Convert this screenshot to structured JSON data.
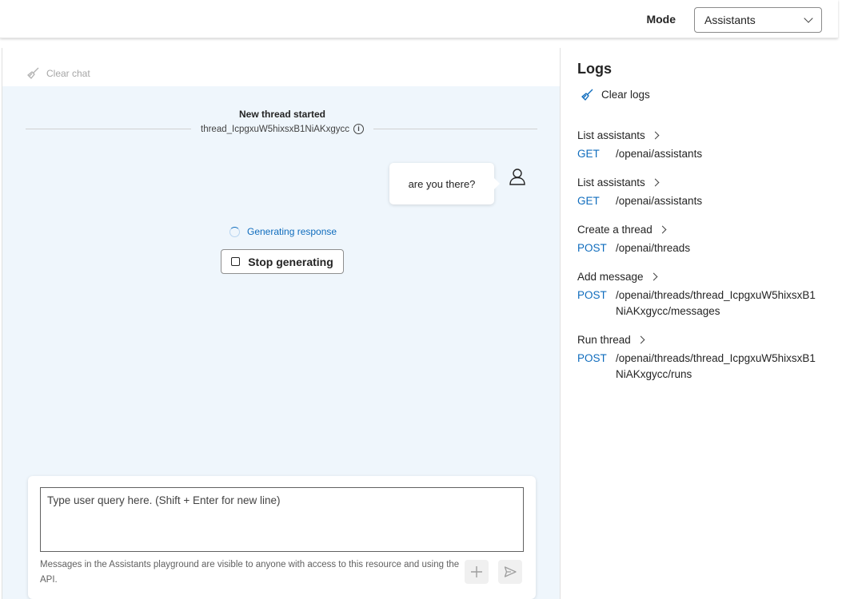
{
  "header": {
    "mode_label": "Mode",
    "mode_value": "Assistants"
  },
  "chat": {
    "clear_chat_label": "Clear chat",
    "thread_title": "New thread started",
    "thread_id": "thread_IcpgxuW5hixsxB1NiAKxgycc",
    "user_message": "are you there?",
    "generating_label": "Generating response",
    "stop_label": "Stop generating",
    "input_placeholder": "Type user query here. (Shift + Enter for new line)",
    "disclaimer": "Messages in the Assistants playground are visible to anyone with access to this resource and using the API."
  },
  "logs": {
    "title": "Logs",
    "clear_label": "Clear logs",
    "items": [
      {
        "name": "List assistants",
        "method": "GET",
        "path": "/openai/assistants"
      },
      {
        "name": "List assistants",
        "method": "GET",
        "path": "/openai/assistants"
      },
      {
        "name": "Create a thread",
        "method": "POST",
        "path": "/openai/threads"
      },
      {
        "name": "Add message",
        "method": "POST",
        "path": "/openai/threads/thread_IcpgxuW5hixsxB1NiAKxgycc/messages"
      },
      {
        "name": "Run thread",
        "method": "POST",
        "path": "/openai/threads/thread_IcpgxuW5hixsxB1NiAKxgycc/runs"
      }
    ]
  },
  "colors": {
    "accent": "#0f6cbd",
    "chat_background": "#eff6fc"
  },
  "icons": {
    "clear_chat": "broom-icon",
    "clear_logs": "broom-icon",
    "user": "person-icon",
    "info": "info-icon",
    "add": "plus-icon",
    "send": "send-icon"
  }
}
